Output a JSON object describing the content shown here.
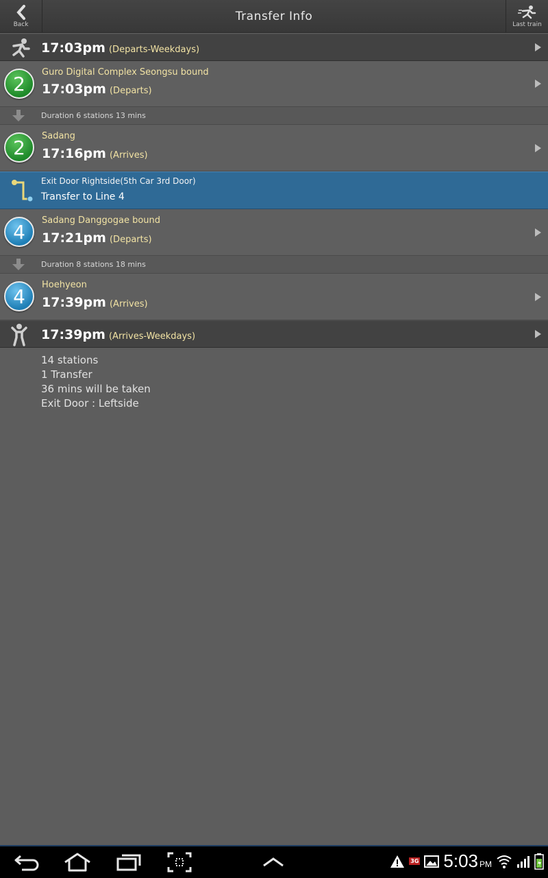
{
  "header": {
    "title": "Transfer Info",
    "back_label": "Back",
    "last_train_label": "Last train"
  },
  "start": {
    "time": "17:03pm",
    "note": "(Departs-Weekdays)"
  },
  "seg1": {
    "line": "2",
    "station": "Guro Digital Complex Seongsu bound",
    "time": "17:03pm",
    "note": "(Departs)"
  },
  "dur1": "Duration 6 stations 13 mins",
  "seg2": {
    "line": "2",
    "station": "Sadang",
    "time": "17:16pm",
    "note": "(Arrives)"
  },
  "transfer": {
    "door": "Exit Door Rightside(5th Car 3rd Door)",
    "label": "Transfer to Line 4"
  },
  "seg3": {
    "line": "4",
    "station": "Sadang Danggogae bound",
    "time": "17:21pm",
    "note": "(Departs)"
  },
  "dur2": "Duration 8 stations 18 mins",
  "seg4": {
    "line": "4",
    "station": "Hoehyeon",
    "time": "17:39pm",
    "note": "(Arrives)"
  },
  "end": {
    "time": "17:39pm",
    "note": "(Arrives-Weekdays)"
  },
  "summary": [
    "14 stations",
    "1 Transfer",
    "36 mins will be taken",
    "Exit Door : Leftside"
  ],
  "status": {
    "clock": "5:03",
    "ampm": "PM",
    "net": "3G"
  },
  "colors": {
    "line2": "#1f8a2a",
    "line4": "#1f7fb6",
    "highlight": "#2f6a96",
    "accent_text": "#f2e3a4"
  }
}
